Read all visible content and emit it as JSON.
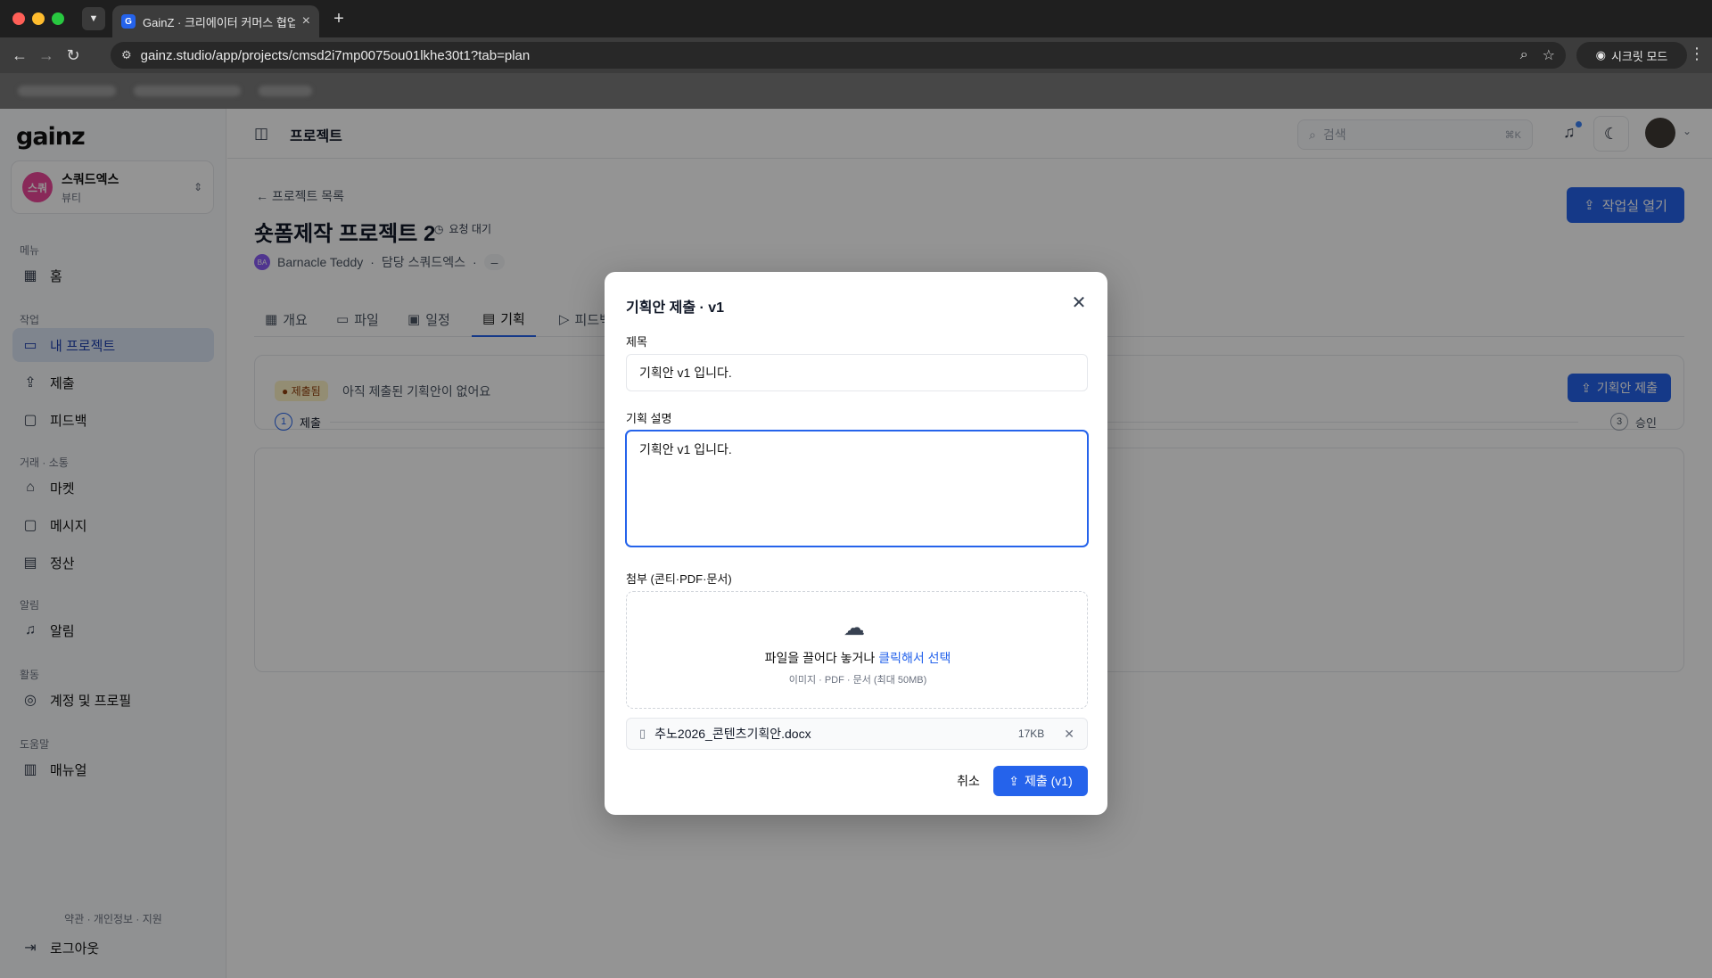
{
  "browser": {
    "tab_title": "GainZ · 크리에이터 커머스 협업 O",
    "favicon_letter": "G",
    "url": "gainz.studio/app/projects/cmsd2i7mp0075ou01lkhe30t1?tab=plan",
    "incognito_label": "시크릿 모드"
  },
  "sidebar": {
    "logo": "gainz",
    "org": {
      "avatar_text": "스쿼",
      "name": "스쿼드엑스",
      "category": "뷰티"
    },
    "sections": {
      "menu": "메뉴",
      "work": "작업",
      "trade": "거래 · 소통",
      "alerts": "알림",
      "activity": "활동",
      "help": "도움말"
    },
    "items": {
      "home": "홈",
      "my_projects": "내 프로젝트",
      "submit": "제출",
      "feedback": "피드백",
      "market": "마켓",
      "messages": "메시지",
      "settlement": "정산",
      "notifications": "알림",
      "account": "계정 및 프로필",
      "manual": "매뉴얼",
      "logout": "로그아웃"
    },
    "footer_links": "약관 · 개인정보 · 지원"
  },
  "topbar": {
    "title": "프로젝트",
    "search_placeholder": "검색",
    "search_shortcut": "⌘K"
  },
  "project": {
    "back_label": "프로젝트 목록",
    "title": "숏폼제작 프로젝트 2",
    "status": "요청 대기",
    "owner_initials": "BA",
    "owner": "Barnacle Teddy",
    "manager": "담당 스쿼드엑스",
    "extra": "–",
    "open_studio": "작업실 열기"
  },
  "tabs": {
    "overview": "개요",
    "files": "파일",
    "schedule": "일정",
    "plan": "기획",
    "feedback": "피드백"
  },
  "plan_card": {
    "badge": "제출됨",
    "empty_text": "아직 제출된 기획안이 없어요",
    "submit_button": "기획안 제출",
    "step1_num": "1",
    "step1_label": "제출",
    "step3_num": "3",
    "step3_label": "승인"
  },
  "modal": {
    "title": "기획안 제출 · v1",
    "title_label": "제목",
    "title_value": "기획안 v1 입니다.",
    "desc_label": "기획 설명",
    "desc_value": "기획안 v1 입니다.",
    "attach_label": "첨부 (콘티·PDF·문서)",
    "drop_text": "파일을 끌어다 놓거나",
    "drop_link": "클릭해서 선택",
    "drop_hint": "이미지 · PDF · 문서 (최대 50MB)",
    "file_name": "추노2026_콘텐츠기획안.docx",
    "file_size": "17KB",
    "cancel": "취소",
    "submit": "제출 (v1)"
  },
  "colors": {
    "accent": "#2563eb",
    "org_avatar": "#ec4899"
  }
}
